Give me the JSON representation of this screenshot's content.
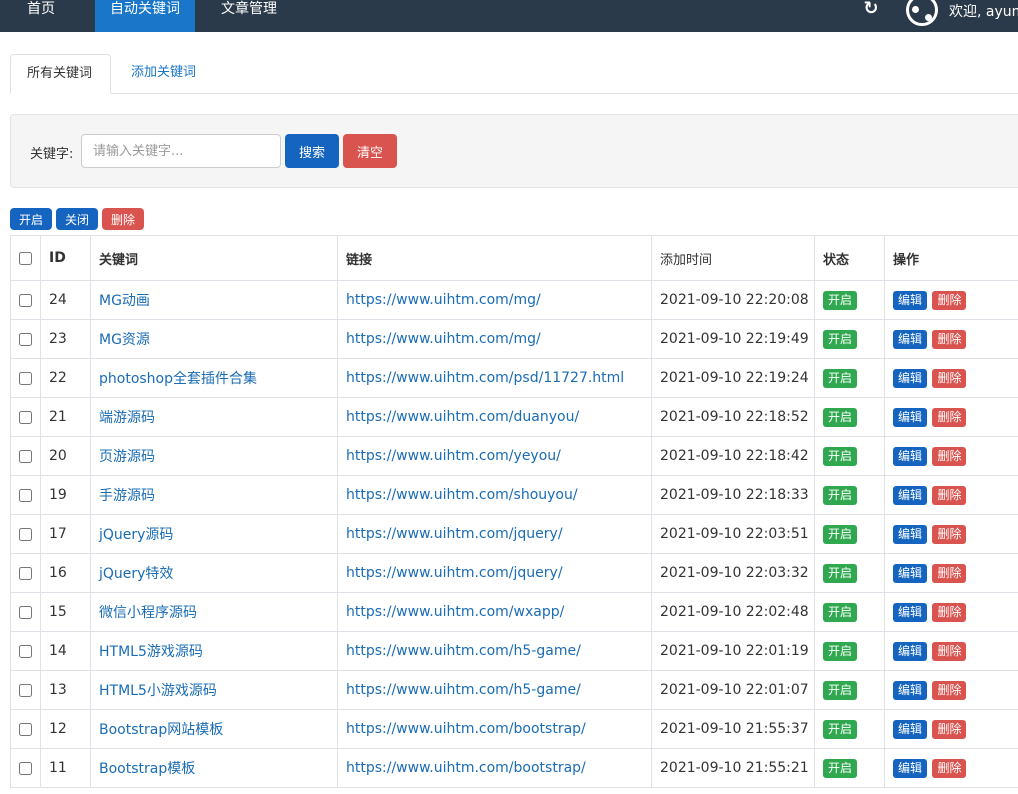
{
  "navbar": {
    "home": "首页",
    "keywords": "自动关键词",
    "articles": "文章管理",
    "refresh_icon": "refresh-icon",
    "avatar_icon": "share-nodes-icon",
    "welcome": "欢迎, ayum"
  },
  "tabs": {
    "all": "所有关键词",
    "add": "添加关键词"
  },
  "search": {
    "label": "关键字:",
    "placeholder": "请输入关键字...",
    "search_button": "搜索",
    "clear_button": "清空"
  },
  "batch": {
    "enable": "开启",
    "disable": "关闭",
    "delete": "删除"
  },
  "table": {
    "headers": {
      "id": "ID",
      "keyword": "关键词",
      "link": "链接",
      "time": "添加时间",
      "status": "状态",
      "actions": "操作"
    },
    "rows": [
      {
        "id": "24",
        "keyword": "MG动画",
        "link": "https://www.uihtm.com/mg/",
        "time": "2021-09-10 22:20:08",
        "status": "开启"
      },
      {
        "id": "23",
        "keyword": "MG资源",
        "link": "https://www.uihtm.com/mg/",
        "time": "2021-09-10 22:19:49",
        "status": "开启"
      },
      {
        "id": "22",
        "keyword": "photoshop全套插件合集",
        "link": "https://www.uihtm.com/psd/11727.html",
        "time": "2021-09-10 22:19:24",
        "status": "开启"
      },
      {
        "id": "21",
        "keyword": "端游源码",
        "link": "https://www.uihtm.com/duanyou/",
        "time": "2021-09-10 22:18:52",
        "status": "开启"
      },
      {
        "id": "20",
        "keyword": "页游源码",
        "link": "https://www.uihtm.com/yeyou/",
        "time": "2021-09-10 22:18:42",
        "status": "开启"
      },
      {
        "id": "19",
        "keyword": "手游源码",
        "link": "https://www.uihtm.com/shouyou/",
        "time": "2021-09-10 22:18:33",
        "status": "开启"
      },
      {
        "id": "17",
        "keyword": "jQuery源码",
        "link": "https://www.uihtm.com/jquery/",
        "time": "2021-09-10 22:03:51",
        "status": "开启"
      },
      {
        "id": "16",
        "keyword": "jQuery特效",
        "link": "https://www.uihtm.com/jquery/",
        "time": "2021-09-10 22:03:32",
        "status": "开启"
      },
      {
        "id": "15",
        "keyword": "微信小程序源码",
        "link": "https://www.uihtm.com/wxapp/",
        "time": "2021-09-10 22:02:48",
        "status": "开启"
      },
      {
        "id": "14",
        "keyword": "HTML5游戏源码",
        "link": "https://www.uihtm.com/h5-game/",
        "time": "2021-09-10 22:01:19",
        "status": "开启"
      },
      {
        "id": "13",
        "keyword": "HTML5小游戏源码",
        "link": "https://www.uihtm.com/h5-game/",
        "time": "2021-09-10 22:01:07",
        "status": "开启"
      },
      {
        "id": "12",
        "keyword": "Bootstrap网站模板",
        "link": "https://www.uihtm.com/bootstrap/",
        "time": "2021-09-10 21:55:37",
        "status": "开启"
      },
      {
        "id": "11",
        "keyword": "Bootstrap模板",
        "link": "https://www.uihtm.com/bootstrap/",
        "time": "2021-09-10 21:55:21",
        "status": "开启"
      }
    ],
    "row_actions": {
      "edit": "编辑",
      "delete": "删除"
    }
  },
  "colors": {
    "navbar_bg": "#2b3a4a",
    "active_nav": "#1976c8",
    "primary": "#1565c0",
    "danger": "#d9534f",
    "success": "#2fa84f",
    "link": "#1a6cb5"
  }
}
